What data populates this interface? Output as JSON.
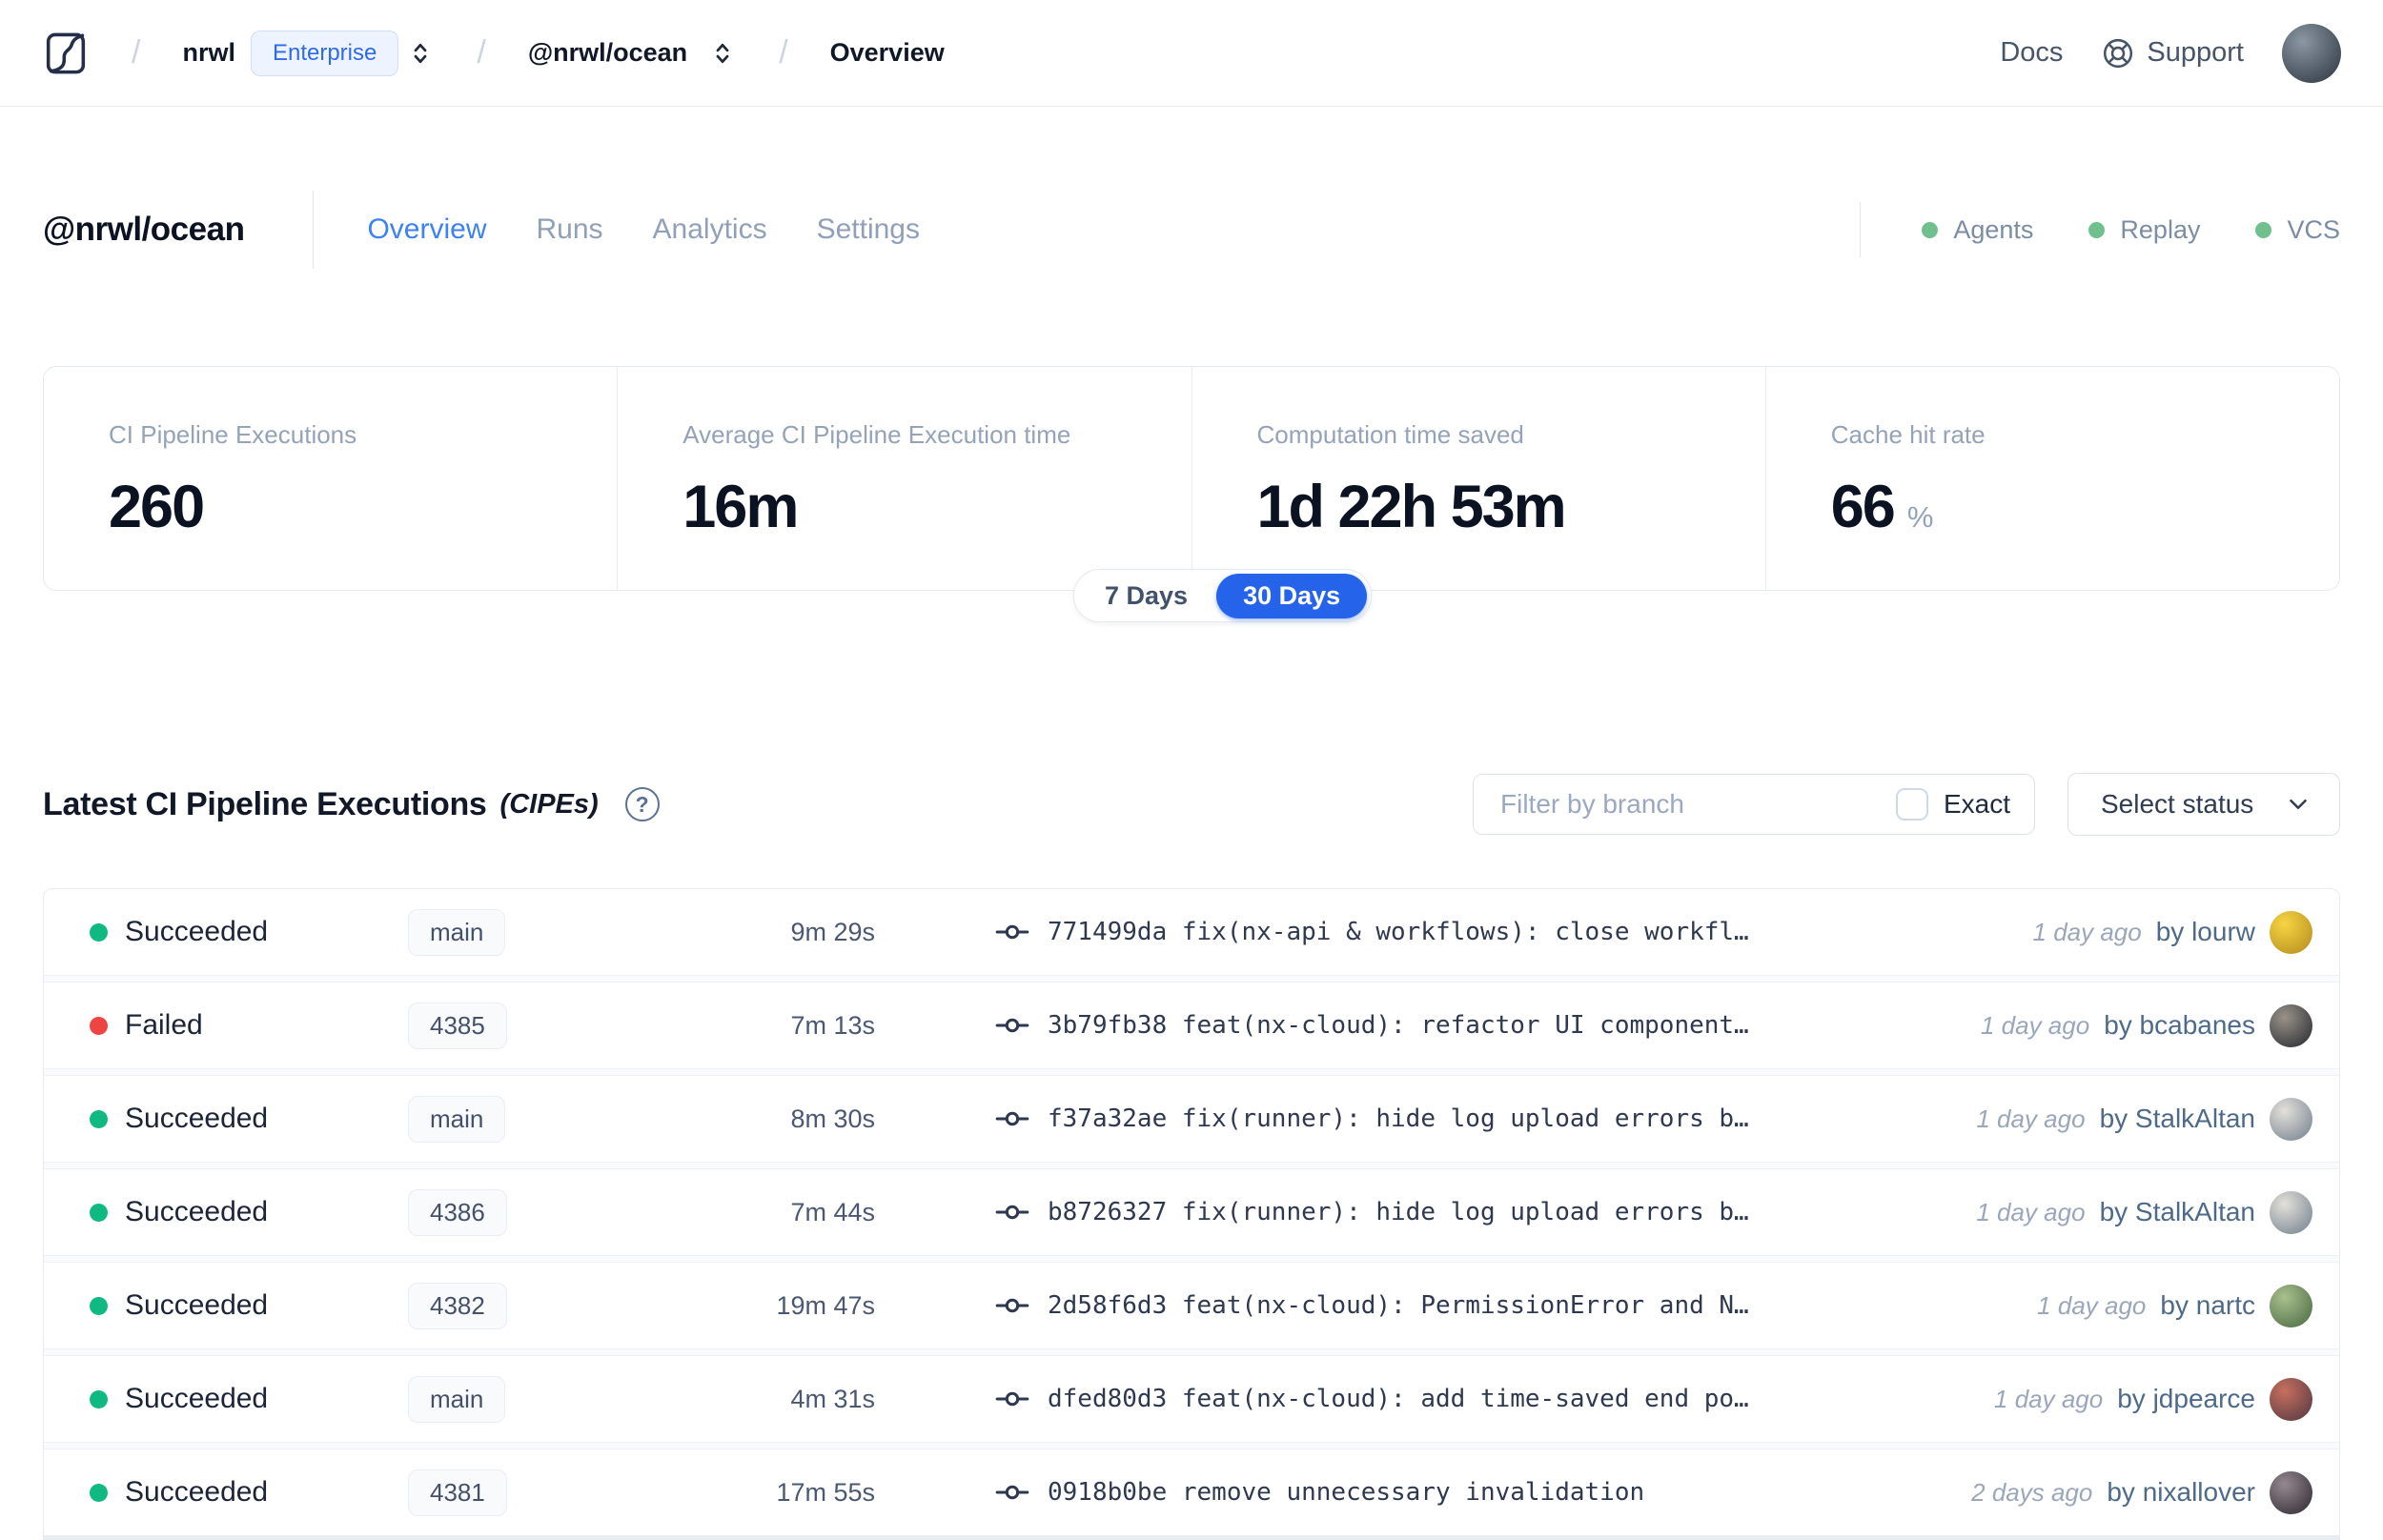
{
  "topbar": {
    "separator": "/",
    "org_name": "nrwl",
    "org_badge": "Enterprise",
    "workspace_name": "@nrwl/ocean",
    "current_page": "Overview",
    "docs_label": "Docs",
    "support_label": "Support"
  },
  "workspace_header": {
    "title": "@nrwl/ocean",
    "tabs": [
      {
        "label": "Overview",
        "active": true
      },
      {
        "label": "Runs",
        "active": false
      },
      {
        "label": "Analytics",
        "active": false
      },
      {
        "label": "Settings",
        "active": false
      }
    ],
    "indicators": [
      {
        "label": "Agents",
        "status_color": "#6fc08d"
      },
      {
        "label": "Replay",
        "status_color": "#6fc08d"
      },
      {
        "label": "VCS",
        "status_color": "#6fc08d"
      }
    ]
  },
  "stats": {
    "cards": [
      {
        "label": "CI Pipeline Executions",
        "value": "260",
        "unit": ""
      },
      {
        "label": "Average CI Pipeline Execution time",
        "value": "16m",
        "unit": ""
      },
      {
        "label": "Computation time saved",
        "value": "1d 22h 53m",
        "unit": ""
      },
      {
        "label": "Cache hit rate",
        "value": "66",
        "unit": "%"
      }
    ],
    "range_toggle": {
      "options": [
        "7 Days",
        "30 Days"
      ],
      "selected": "30 Days"
    }
  },
  "cipe_section": {
    "title": "Latest CI Pipeline Executions",
    "title_suffix": "(CIPEs)",
    "help_glyph": "?",
    "branch_filter_placeholder": "Filter by branch",
    "branch_filter_value": "",
    "exact_label": "Exact",
    "exact_checked": false,
    "status_select_label": "Select status"
  },
  "cipe_table": {
    "rows": [
      {
        "status": "Succeeded",
        "status_color": "#10b981",
        "branch": "main",
        "duration": "9m 29s",
        "commit": "771499da fix(nx-api & workflows): close workfl…",
        "time_ago": "1 day ago",
        "author": "by lourw",
        "avatar": {
          "c1": "#f6d544",
          "c2": "#b3891c"
        }
      },
      {
        "status": "Failed",
        "status_color": "#ef4444",
        "branch": "4385",
        "duration": "7m 13s",
        "commit": "3b79fb38 feat(nx-cloud): refactor UI component…",
        "time_ago": "1 day ago",
        "author": "by bcabanes",
        "avatar": {
          "c1": "#9a9288",
          "c2": "#23262e"
        }
      },
      {
        "status": "Succeeded",
        "status_color": "#10b981",
        "branch": "main",
        "duration": "8m 30s",
        "commit": "f37a32ae fix(runner): hide log upload errors b…",
        "time_ago": "1 day ago",
        "author": "by StalkAltan",
        "avatar": {
          "c1": "#e3e0da",
          "c2": "#707e8c"
        }
      },
      {
        "status": "Succeeded",
        "status_color": "#10b981",
        "branch": "4386",
        "duration": "7m 44s",
        "commit": "b8726327 fix(runner): hide log upload errors b…",
        "time_ago": "1 day ago",
        "author": "by StalkAltan",
        "avatar": {
          "c1": "#e3e0da",
          "c2": "#707e8c"
        }
      },
      {
        "status": "Succeeded",
        "status_color": "#10b981",
        "branch": "4382",
        "duration": "19m 47s",
        "commit": "2d58f6d3 feat(nx-cloud): PermissionError and N…",
        "time_ago": "1 day ago",
        "author": "by nartc",
        "avatar": {
          "c1": "#a9c08e",
          "c2": "#47663f"
        }
      },
      {
        "status": "Succeeded",
        "status_color": "#10b981",
        "branch": "main",
        "duration": "4m 31s",
        "commit": "dfed80d3 feat(nx-cloud): add time-saved end po…",
        "time_ago": "1 day ago",
        "author": "by jdpearce",
        "avatar": {
          "c1": "#c86f5e",
          "c2": "#4e3742"
        }
      },
      {
        "status": "Succeeded",
        "status_color": "#10b981",
        "branch": "4381",
        "duration": "17m 55s",
        "commit": "0918b0be remove unnecessary invalidation",
        "time_ago": "2 days ago",
        "author": "by nixallover",
        "avatar": {
          "c1": "#95898f",
          "c2": "#2c2630"
        }
      }
    ]
  },
  "user": {
    "avatar_colors": {
      "c1": "#8b97a3",
      "c2": "#2a323d"
    }
  },
  "colors": {
    "accent_blue": "#3b82f6",
    "toggle_blue": "#2563eb",
    "succeeded_green": "#10b981",
    "failed_red": "#ef4444"
  }
}
